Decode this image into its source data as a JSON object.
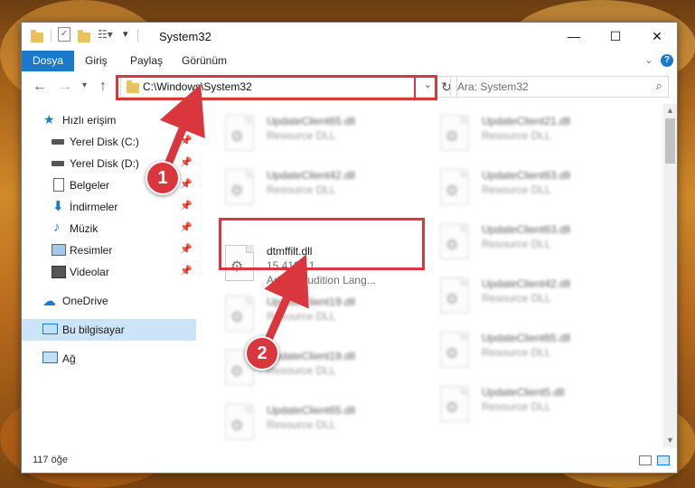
{
  "window": {
    "title": "System32",
    "minimize": "—",
    "maximize": "☐",
    "close": "✕"
  },
  "ribbon": {
    "tabs": [
      "Dosya",
      "Giriş",
      "Paylaş",
      "Görünüm"
    ],
    "help": "?"
  },
  "nav": {
    "address": "C:\\Windows\\System32",
    "search_placeholder": "Ara: System32"
  },
  "sidebar": {
    "quick_access": "Hızlı erişim",
    "items": [
      {
        "label": "Yerel Disk (C:)",
        "icon": "drive-icon"
      },
      {
        "label": "Yerel Disk (D:)",
        "icon": "drive-icon"
      },
      {
        "label": "Belgeler",
        "icon": "documents-icon"
      },
      {
        "label": "İndirmeler",
        "icon": "download-icon"
      },
      {
        "label": "Müzik",
        "icon": "music-icon"
      },
      {
        "label": "Resimler",
        "icon": "pictures-icon"
      },
      {
        "label": "Videolar",
        "icon": "videos-icon"
      }
    ],
    "onedrive": "OneDrive",
    "this_pc": "Bu bilgisayar",
    "network": "Ağ"
  },
  "files": {
    "left_column": [
      {
        "name": "UpdateClient65.dll",
        "desc": "Resource DLL"
      },
      {
        "name": "UpdateClient42.dll",
        "desc": "Resource DLL"
      },
      {
        "name": "dtmffilt.dll",
        "version": "15.4124.1",
        "desc": "Adobe Audition Lang..."
      },
      {
        "name": "UpdateClient19.dll",
        "desc": "Resource DLL"
      },
      {
        "name": "UpdateClient19.dll",
        "desc": "Resource DLL"
      },
      {
        "name": "UpdateClient65.dll",
        "desc": "Resource DLL"
      }
    ],
    "right_column": [
      {
        "name": "UpdateClient21.dll",
        "desc": "Resource DLL"
      },
      {
        "name": "UpdateClient63.dll",
        "desc": "Resource DLL"
      },
      {
        "name": "UpdateClient63.dll",
        "desc": "Resource DLL"
      },
      {
        "name": "UpdateClient42.dll",
        "desc": "Resource DLL"
      },
      {
        "name": "UpdateClient65.dll",
        "desc": "Resource DLL"
      },
      {
        "name": "UpdateClient5.dll",
        "desc": "Resource DLL"
      }
    ]
  },
  "status": {
    "item_count": "117 öğe"
  },
  "annotations": {
    "step1": "1",
    "step2": "2",
    "color": "#d9363e"
  }
}
